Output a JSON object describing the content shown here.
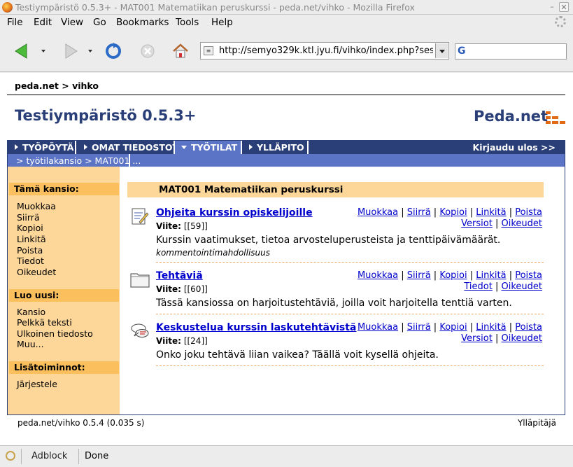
{
  "window": {
    "title": "Testiympäristö 0.5.3+ - MAT001 Matematiikan peruskurssi - peda.net/vihko - Mozilla Firefox",
    "minimize_glyph": "–",
    "close_glyph": "✕"
  },
  "menu": [
    "File",
    "Edit",
    "View",
    "Go",
    "Bookmarks",
    "Tools",
    "Help"
  ],
  "toolbar": {
    "url": "http://semyo329k.ktl.jyu.fi/vihko/index.php?sess",
    "search_value": ""
  },
  "page": {
    "top_breadcrumb": "peda.net > vihko",
    "site_title": "Testiympäristö 0.5.3+",
    "logo_text": "Peda.net",
    "tabs": [
      "TYÖPÖYTÄ",
      "OMAT TIEDOSTOT",
      "TYÖTILAT",
      "YLLÄPITO"
    ],
    "active_tab": "TYÖTILAT",
    "logout": "Kirjaudu ulos >>",
    "path": "> työtilakansio > MAT001 ...",
    "sidebar": {
      "this_folder_heading": "Tämä kansio:",
      "this_folder_items": [
        "Muokkaa",
        "Siirrä",
        "Kopioi",
        "Linkitä",
        "Poista",
        "Tiedot",
        "Oikeudet"
      ],
      "create_heading": "Luo uusi:",
      "create_items": [
        "Kansio",
        "Pelkkä teksti",
        "Ulkoinen tiedosto",
        "Muu..."
      ],
      "extra_heading": "Lisätoiminnot:",
      "extra_items": [
        "Järjestele"
      ]
    },
    "folder_heading": "MAT001 Matematiikan peruskurssi",
    "items": [
      {
        "title": "Ohjeita kurssin opiskelijoille",
        "ref_label": "Viite:",
        "ref_value": "[[59]]",
        "description": "Kurssin vaatimukset, tietoa arvosteluperusteista ja tenttipäivämäärät.",
        "note": "kommentointimahdollisuus",
        "icon": "document-edit-icon",
        "actions_row1": [
          "Muokkaa",
          "Siirrä",
          "Kopioi",
          "Linkitä",
          "Poista"
        ],
        "actions_row2": [
          "Versiot",
          "Oikeudet"
        ]
      },
      {
        "title": "Tehtäviä",
        "ref_label": "Viite:",
        "ref_value": "[[60]]",
        "description": "Tässä kansiossa on harjoitustehtäviä, joilla voit harjoitella tenttiä varten.",
        "note": "",
        "icon": "folder-icon",
        "actions_row1": [
          "Muokkaa",
          "Siirrä",
          "Kopioi",
          "Linkitä",
          "Poista"
        ],
        "actions_row2": [
          "Tiedot",
          "Oikeudet"
        ]
      },
      {
        "title": "Keskustelua kurssin laskutehtävistä",
        "ref_label": "Viite:",
        "ref_value": "[[24]]",
        "description": "Onko joku tehtävä liian vaikea? Täällä voit kysellä ohjeita.",
        "note": "",
        "icon": "discussion-icon",
        "actions_row1": [
          "Muokkaa",
          "Siirrä",
          "Kopioi",
          "Linkitä",
          "Poista"
        ],
        "actions_row2": [
          "Versiot",
          "Oikeudet"
        ]
      }
    ],
    "footer_left": "peda.net/vihko 0.5.4 (0.035 s)",
    "footer_right": "Ylläpitäjä"
  },
  "status": {
    "adblock": "Adblock",
    "text": "Done"
  },
  "colors": {
    "navy": "#2a3f78",
    "tab_active": "#5b74c6",
    "sidebar_bg": "#fdd79a",
    "sidebar_head": "#fbbf5e",
    "link": "#0000cc",
    "logo_accent": "#e06b14"
  }
}
